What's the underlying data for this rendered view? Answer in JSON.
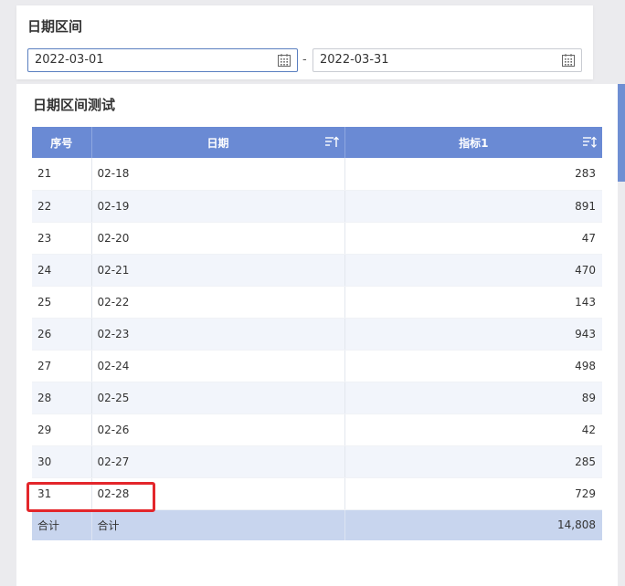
{
  "filter": {
    "title": "日期区间",
    "start_value": "2022-03-01",
    "separator": "-",
    "end_value": "2022-03-31"
  },
  "table": {
    "title": "日期区间测试",
    "headers": [
      "序号",
      "日期",
      "指标1"
    ],
    "rows": [
      {
        "seq": "21",
        "date": "02-18",
        "metric": "283"
      },
      {
        "seq": "22",
        "date": "02-19",
        "metric": "891"
      },
      {
        "seq": "23",
        "date": "02-20",
        "metric": "47"
      },
      {
        "seq": "24",
        "date": "02-21",
        "metric": "470"
      },
      {
        "seq": "25",
        "date": "02-22",
        "metric": "143"
      },
      {
        "seq": "26",
        "date": "02-23",
        "metric": "943"
      },
      {
        "seq": "27",
        "date": "02-24",
        "metric": "498"
      },
      {
        "seq": "28",
        "date": "02-25",
        "metric": "89"
      },
      {
        "seq": "29",
        "date": "02-26",
        "metric": "42"
      },
      {
        "seq": "30",
        "date": "02-27",
        "metric": "285"
      },
      {
        "seq": "31",
        "date": "02-28",
        "metric": "729"
      }
    ],
    "footer": {
      "seq": "合计",
      "date": "合计",
      "metric": "14,808"
    }
  },
  "colors": {
    "header_bg": "#6a8ad4",
    "footer_bg": "#c8d5ee",
    "highlight": "#e3262b"
  }
}
